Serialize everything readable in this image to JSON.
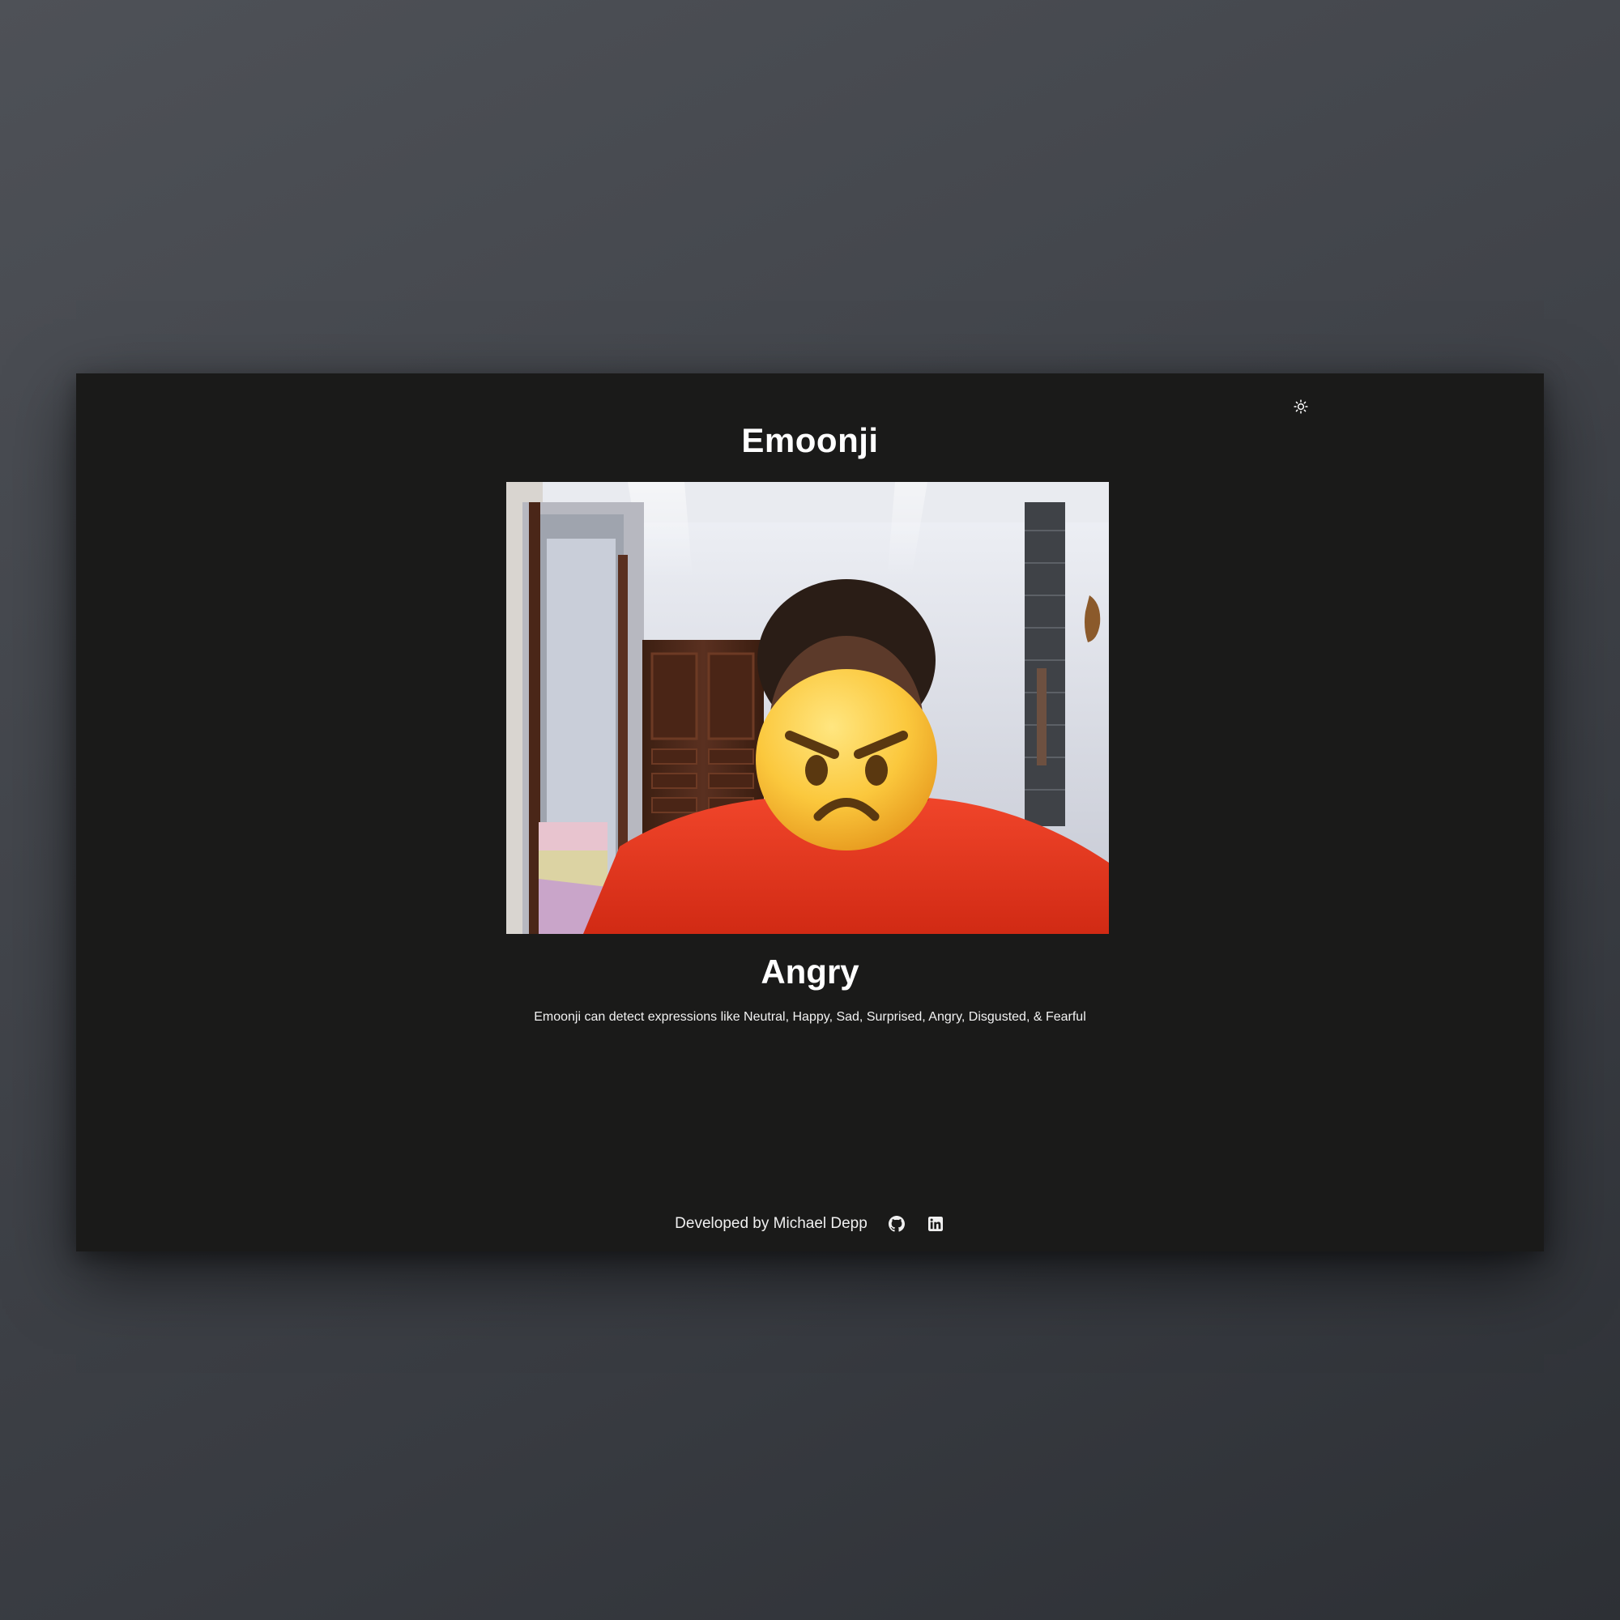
{
  "app": {
    "title": "Emoonji"
  },
  "header": {
    "theme_toggle_icon": "sun-icon"
  },
  "webcam": {
    "overlay_emoji_icon": "angry-face-emoji"
  },
  "result": {
    "expression": "Angry"
  },
  "description": "Emoonji can detect expressions like Neutral, Happy, Sad, Surprised, Angry, Disgusted, & Fearful",
  "footer": {
    "credit": "Developed by Michael Depp",
    "links": [
      {
        "icon": "github-icon"
      },
      {
        "icon": "linkedin-icon"
      }
    ]
  },
  "colors": {
    "page_background": "#45484e",
    "window_background": "#1a1a19",
    "text": "#ffffff",
    "emoji_face": "#f7c53c",
    "shirt": "#e8321c"
  }
}
